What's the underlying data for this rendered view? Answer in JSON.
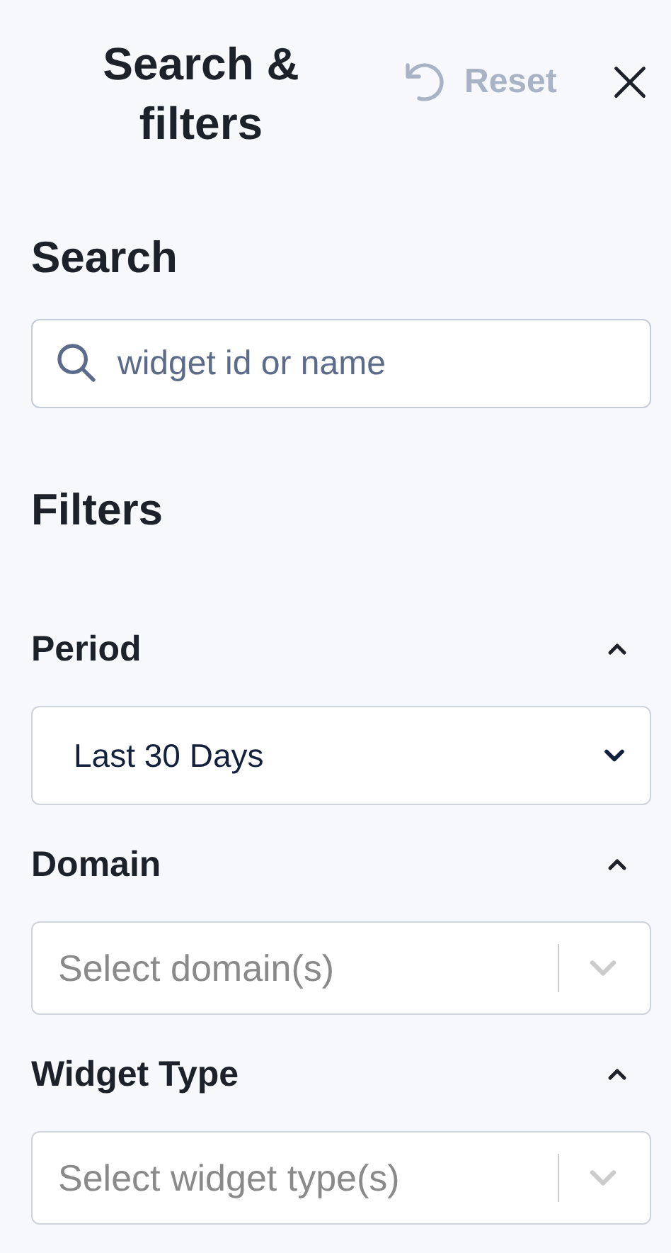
{
  "header": {
    "title": "Search & filters",
    "reset": "Reset"
  },
  "search": {
    "heading": "Search",
    "placeholder": "widget id or name"
  },
  "filters": {
    "heading": "Filters",
    "items": [
      {
        "label": "Period",
        "expanded": true,
        "kind": "select",
        "value": "Last 30 Days"
      },
      {
        "label": "Domain",
        "expanded": true,
        "kind": "multiselect",
        "placeholder": "Select domain(s)"
      },
      {
        "label": "Widget Type",
        "expanded": true,
        "kind": "multiselect",
        "placeholder": "Select widget type(s)"
      }
    ]
  }
}
